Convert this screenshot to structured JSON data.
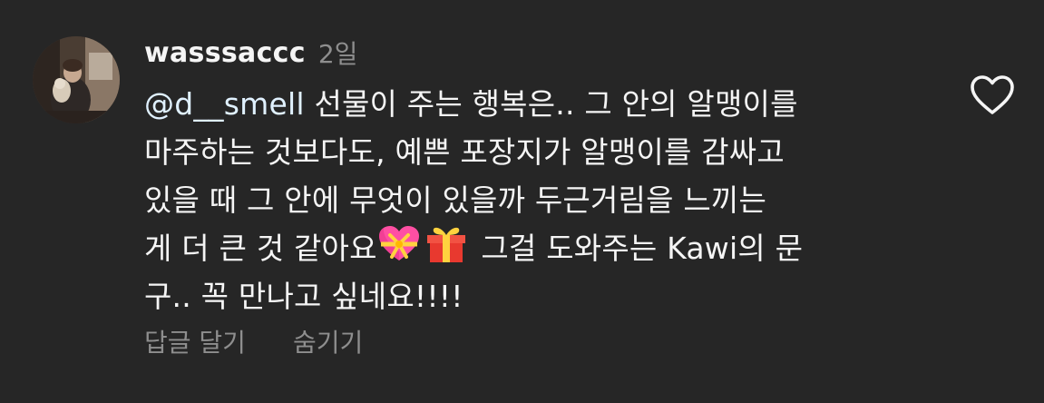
{
  "comment": {
    "username": "wasssaccc",
    "time_ago": "2일",
    "mention": "@d__smell",
    "lines": [
      "선물이 주는 행복은.. 그 안의 알맹이를",
      "마주하는 것보다도, 예쁜 포장지가 알맹이를 감싸고",
      "있을 때 그 안에 무엇이 있을까 두근거림을 느끼는",
      "게 더 큰 것 같아요",
      "그걸 도와주는 Kawi의 문",
      "구.. 꼭 만나고 싶네요!!!!"
    ],
    "emojis": [
      "heart-with-ribbon-icon",
      "wrapped-gift-icon"
    ]
  },
  "actions": {
    "reply_label": "답글 달기",
    "hide_label": "숨기기"
  },
  "colors": {
    "background": "#262626",
    "text": "#f5f5f5",
    "muted": "#8e8e8e",
    "mention": "#e0f1ff"
  }
}
